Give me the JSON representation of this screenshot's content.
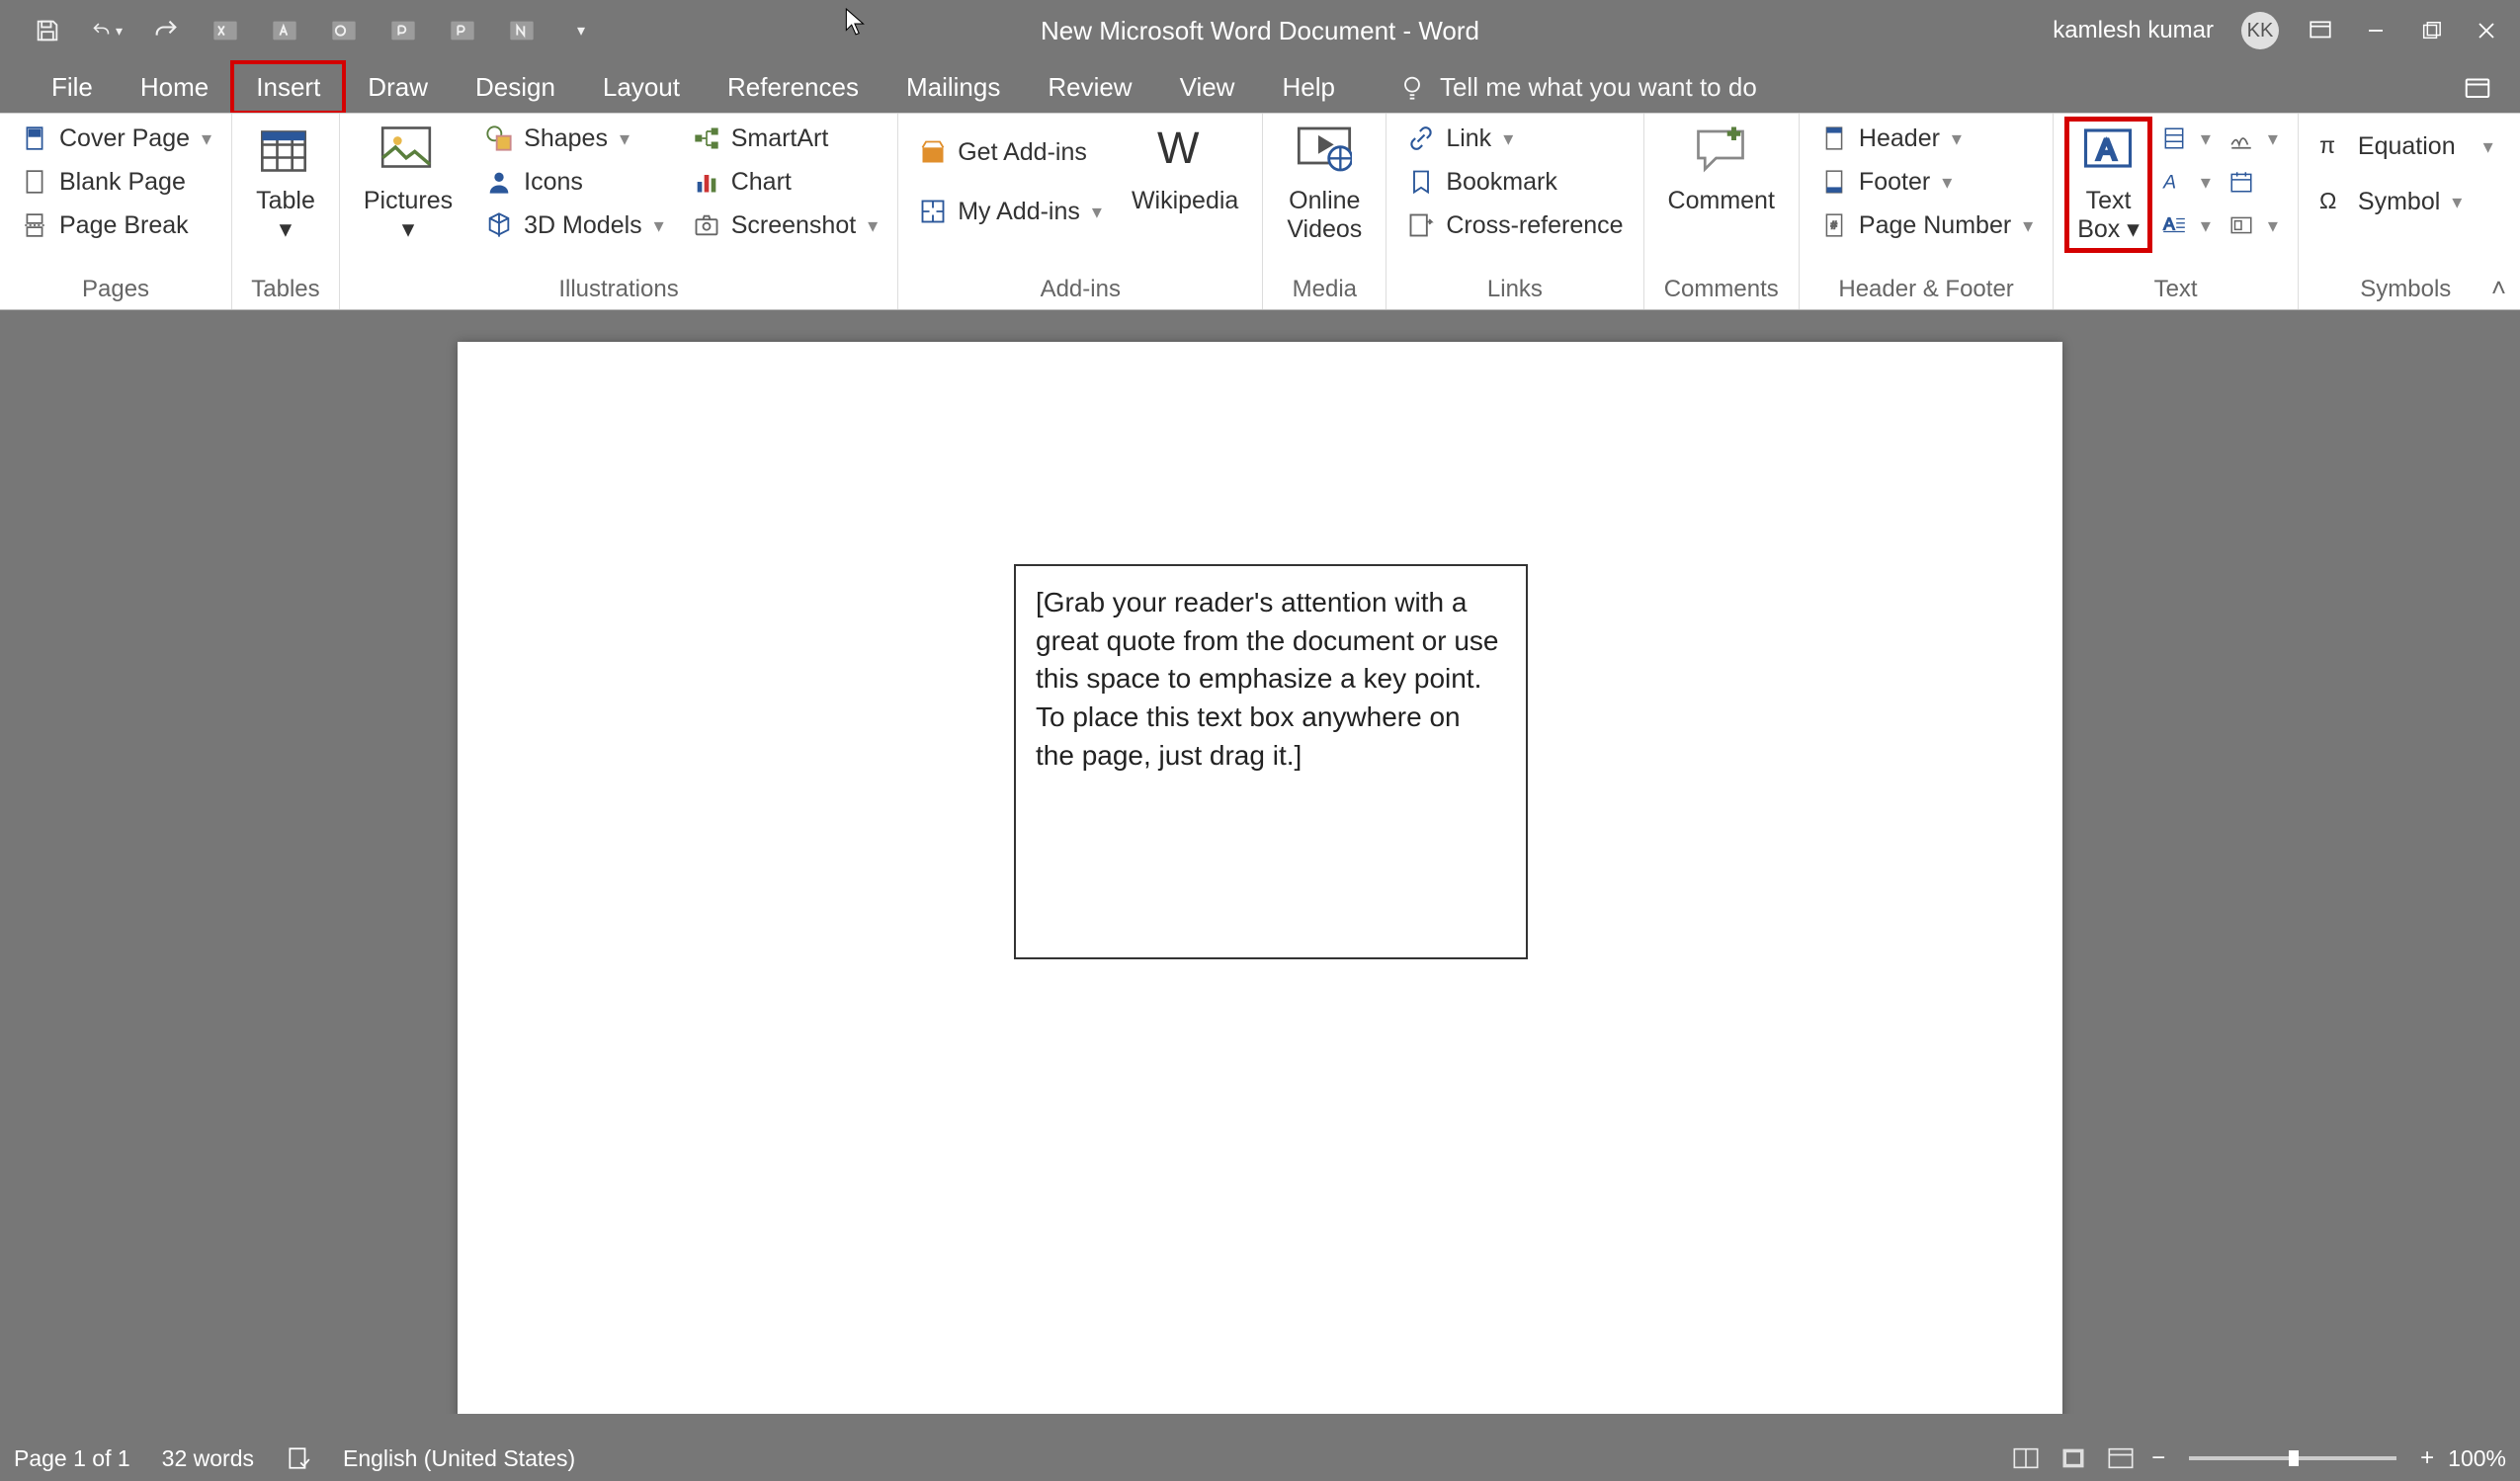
{
  "titlebar": {
    "document_title": "New Microsoft Word Document  -  Word",
    "user_name": "kamlesh kumar",
    "user_initials": "KK"
  },
  "menutabs": {
    "file": "File",
    "home": "Home",
    "insert": "Insert",
    "draw": "Draw",
    "design": "Design",
    "layout": "Layout",
    "references": "References",
    "mailings": "Mailings",
    "review": "Review",
    "view": "View",
    "help": "Help",
    "tell_me": "Tell me what you want to do"
  },
  "ribbon": {
    "pages": {
      "cover_page": "Cover Page",
      "blank_page": "Blank Page",
      "page_break": "Page Break",
      "group": "Pages"
    },
    "tables": {
      "table": "Table",
      "group": "Tables"
    },
    "illustrations": {
      "pictures": "Pictures",
      "shapes": "Shapes",
      "icons": "Icons",
      "models_3d": "3D Models",
      "smartart": "SmartArt",
      "chart": "Chart",
      "screenshot": "Screenshot",
      "group": "Illustrations"
    },
    "addins": {
      "get": "Get Add-ins",
      "my": "My Add-ins",
      "wikipedia": "Wikipedia",
      "group": "Add-ins"
    },
    "media": {
      "online_videos": "Online\nVideos",
      "group": "Media"
    },
    "links": {
      "link": "Link",
      "bookmark": "Bookmark",
      "crossref": "Cross-reference",
      "group": "Links"
    },
    "comments": {
      "comment": "Comment",
      "group": "Comments"
    },
    "headerfooter": {
      "header": "Header",
      "footer": "Footer",
      "page_number": "Page Number",
      "group": "Header & Footer"
    },
    "text": {
      "textbox": "Text\nBox",
      "group": "Text"
    },
    "symbols": {
      "equation": "Equation",
      "symbol": "Symbol",
      "group": "Symbols"
    }
  },
  "document": {
    "textbox_content": "[Grab your reader's attention with a great quote from the document or use this space to emphasize a key point. To place this text box anywhere on the page, just drag it.]"
  },
  "statusbar": {
    "page": "Page 1 of 1",
    "words": "32 words",
    "language": "English (United States)",
    "zoom": "100%"
  }
}
